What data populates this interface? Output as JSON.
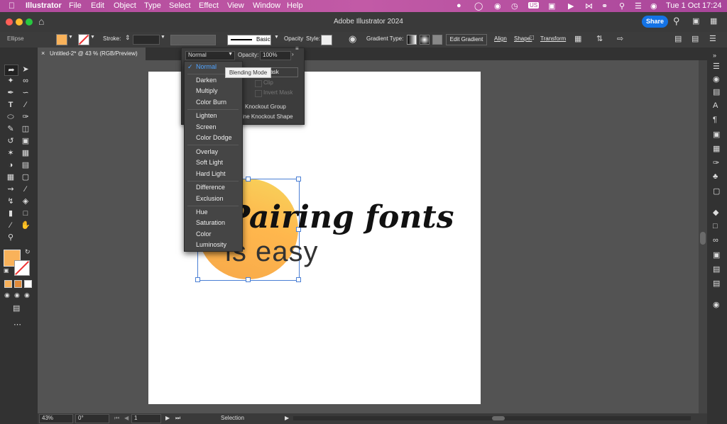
{
  "menubar": {
    "apple_icon": "",
    "app_name": "Illustrator",
    "menus": [
      "File",
      "Edit",
      "Object",
      "Type",
      "Select",
      "Effect",
      "View",
      "Window",
      "Help"
    ],
    "status_icons": [
      "google-icon",
      "creative-cloud-icon",
      "record-icon",
      "clock-icon"
    ],
    "input_source": "US",
    "date_time": "Tue 1 Oct  17:24"
  },
  "titlebar": {
    "title": "Adobe Illustrator 2024",
    "share_label": "Share"
  },
  "controlbar": {
    "selection_type": "Ellipse",
    "stroke_label": "Stroke:",
    "brush_label": "Basic",
    "opacity_label": "Opacity",
    "style_label": "Style:",
    "gradient_type_label": "Gradient Type:",
    "edit_gradient_label": "Edit Gradient",
    "align_label": "Align",
    "shape_label": "Shape:",
    "transform_label": "Transform"
  },
  "document": {
    "tab_title": "Untitled-2* @ 43 % (RGB/Preview)"
  },
  "transparency_panel": {
    "blend_mode_value": "Normal",
    "opacity_label": "Opacity:",
    "opacity_value": "100%",
    "make_mask_label": "e Mask",
    "clip_label": "Clip",
    "invert_mask_label": "Invert Mask",
    "knockout_group_label": "Knockout Group",
    "define_knockout_label": "ine Knockout Shape"
  },
  "blend_menu": {
    "tooltip": "Blending Mode",
    "groups": [
      [
        "Normal"
      ],
      [
        "Darken",
        "Multiply",
        "Color Burn"
      ],
      [
        "Lighten",
        "Screen",
        "Color Dodge"
      ],
      [
        "Overlay",
        "Soft Light",
        "Hard Light"
      ],
      [
        "Difference",
        "Exclusion"
      ],
      [
        "Hue",
        "Saturation",
        "Color",
        "Luminosity"
      ]
    ],
    "selected": "Normal",
    "accent_color": "#4fa3ff"
  },
  "canvas": {
    "headline": "Pairing fonts",
    "subline": "is easy",
    "circle_gradient": [
      "#ffb74d",
      "#f7a94a",
      "#f6d55c"
    ]
  },
  "statusbar": {
    "zoom": "43%",
    "rotation": "0°",
    "artboard_number": "1",
    "tool_status": "Selection"
  },
  "colors": {
    "fill_color": "#f9b25a"
  }
}
